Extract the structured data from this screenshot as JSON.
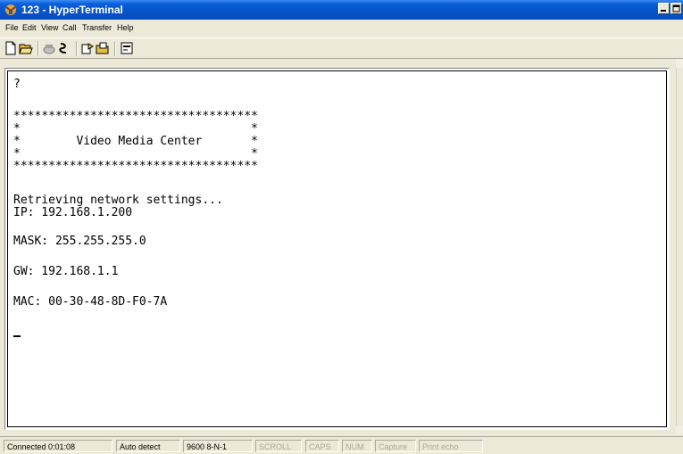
{
  "window": {
    "title": "123 - HyperTerminal"
  },
  "menubar": {
    "items": [
      "File",
      "Edit",
      "View",
      "Call",
      "Transfer",
      "Help"
    ]
  },
  "toolbar": {
    "buttons": [
      "new-icon",
      "open-icon",
      "connect-icon",
      "disconnect-icon",
      "send-icon",
      "receive-icon",
      "properties-icon"
    ]
  },
  "terminal": {
    "lines": [
      "?",
      "",
      "***********************************",
      "*                                 *",
      "*        Video Media Center       *",
      "*                                 *",
      "***********************************",
      "",
      "Retrieving network settings...",
      "IP: 192.168.1.200",
      "",
      "MASK: 255.255.255.0",
      "",
      "GW: 192.168.1.1",
      "",
      "MAC: 00-30-48-8D-F0-7A"
    ]
  },
  "statusbar": {
    "connected": "Connected 0:01:08",
    "detect": "Auto detect",
    "settings": "9600 8-N-1",
    "scroll": "SCROLL",
    "caps": "CAPS",
    "num": "NUM",
    "capture": "Capture",
    "print_echo": "Print echo"
  },
  "colors": {
    "titlebar": "#0553c9",
    "chrome": "#ece9d8",
    "terminal_bg": "#ffffff",
    "terminal_text": "#000000"
  }
}
